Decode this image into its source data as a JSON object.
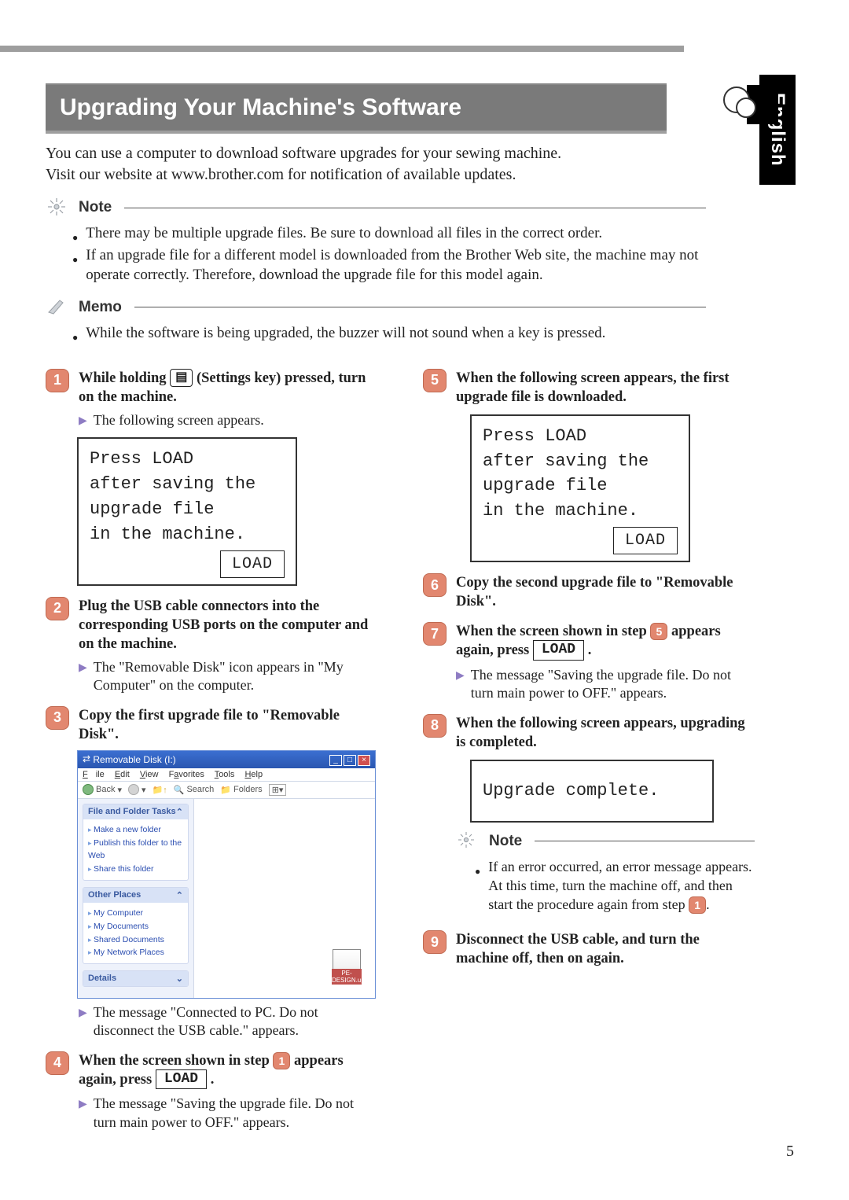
{
  "language_tab": "English",
  "page_number": "5",
  "title": "Upgrading Your Machine's Software",
  "intro_line1": "You can use a computer to download software upgrades for your sewing machine.",
  "intro_line2": "Visit our website at www.brother.com for notification of available updates.",
  "note": {
    "label": "Note",
    "b1": "There may be multiple upgrade files. Be sure to download all files in the correct order.",
    "b2": "If an upgrade file for a different model is downloaded from the Brother Web site, the machine may not operate correctly. Therefore, download the upgrade file for this model again."
  },
  "memo": {
    "label": "Memo",
    "b1": "While the software is being upgraded, the buzzer will not sound when a key is pressed."
  },
  "lcd": {
    "l1": "Press LOAD",
    "l2": "after saving the",
    "l3": "upgrade file",
    "l4": "in the machine.",
    "load": "LOAD",
    "complete": "Upgrade complete."
  },
  "steps": {
    "s1_a": "While holding ",
    "s1_key": "▤",
    "s1_b": " (Settings key) pressed, turn on the machine.",
    "s1_sub": "The following screen appears.",
    "s2": "Plug the USB cable connectors into the corresponding USB ports on the computer and on the machine.",
    "s2_sub": "The \"Removable Disk\" icon appears in \"My Computer\" on the computer.",
    "s3": "Copy the first upgrade file to \"Removable Disk\".",
    "s3_sub": "The message \"Connected to PC. Do not disconnect the USB cable.\" appears.",
    "s4_a": "When the screen shown in step ",
    "s4_n": "1",
    "s4_b": " appears again, press ",
    "s4_c": ".",
    "s4_sub": "The message \"Saving the upgrade file. Do not turn main power to OFF.\" appears.",
    "s5": "When the following screen appears, the first upgrade file is downloaded.",
    "s6": "Copy the second upgrade file to \"Removable Disk\".",
    "s7_a": "When the screen shown in step ",
    "s7_n": "5",
    "s7_b": " appears again, press ",
    "s7_c": ".",
    "s7_sub": "The message \"Saving the upgrade file. Do not turn main power to OFF.\" appears.",
    "s8": "When the following screen appears, upgrading is completed.",
    "s9": "Disconnect the USB cable, and turn the machine off, then on again."
  },
  "inner_note": {
    "label": "Note",
    "text_a": "If an error occurred, an error message appears. At this time, turn the machine off, and then start the procedure again from step ",
    "ref": "1",
    "text_b": "."
  },
  "win": {
    "title": "Removable Disk (I:)",
    "menu": {
      "file": "File",
      "edit": "Edit",
      "view": "View",
      "fav": "Favorites",
      "tools": "Tools",
      "help": "Help"
    },
    "toolbar": {
      "back": "Back",
      "search": "Search",
      "folders": "Folders"
    },
    "panel1": {
      "title": "File and Folder Tasks",
      "i1": "Make a new folder",
      "i2": "Publish this folder to the Web",
      "i3": "Share this folder"
    },
    "panel2": {
      "title": "Other Places",
      "i1": "My Computer",
      "i2": "My Documents",
      "i3": "Shared Documents",
      "i4": "My Network Places"
    },
    "panel3": {
      "title": "Details"
    },
    "filelabel": "PE-DESIGN.upf"
  }
}
